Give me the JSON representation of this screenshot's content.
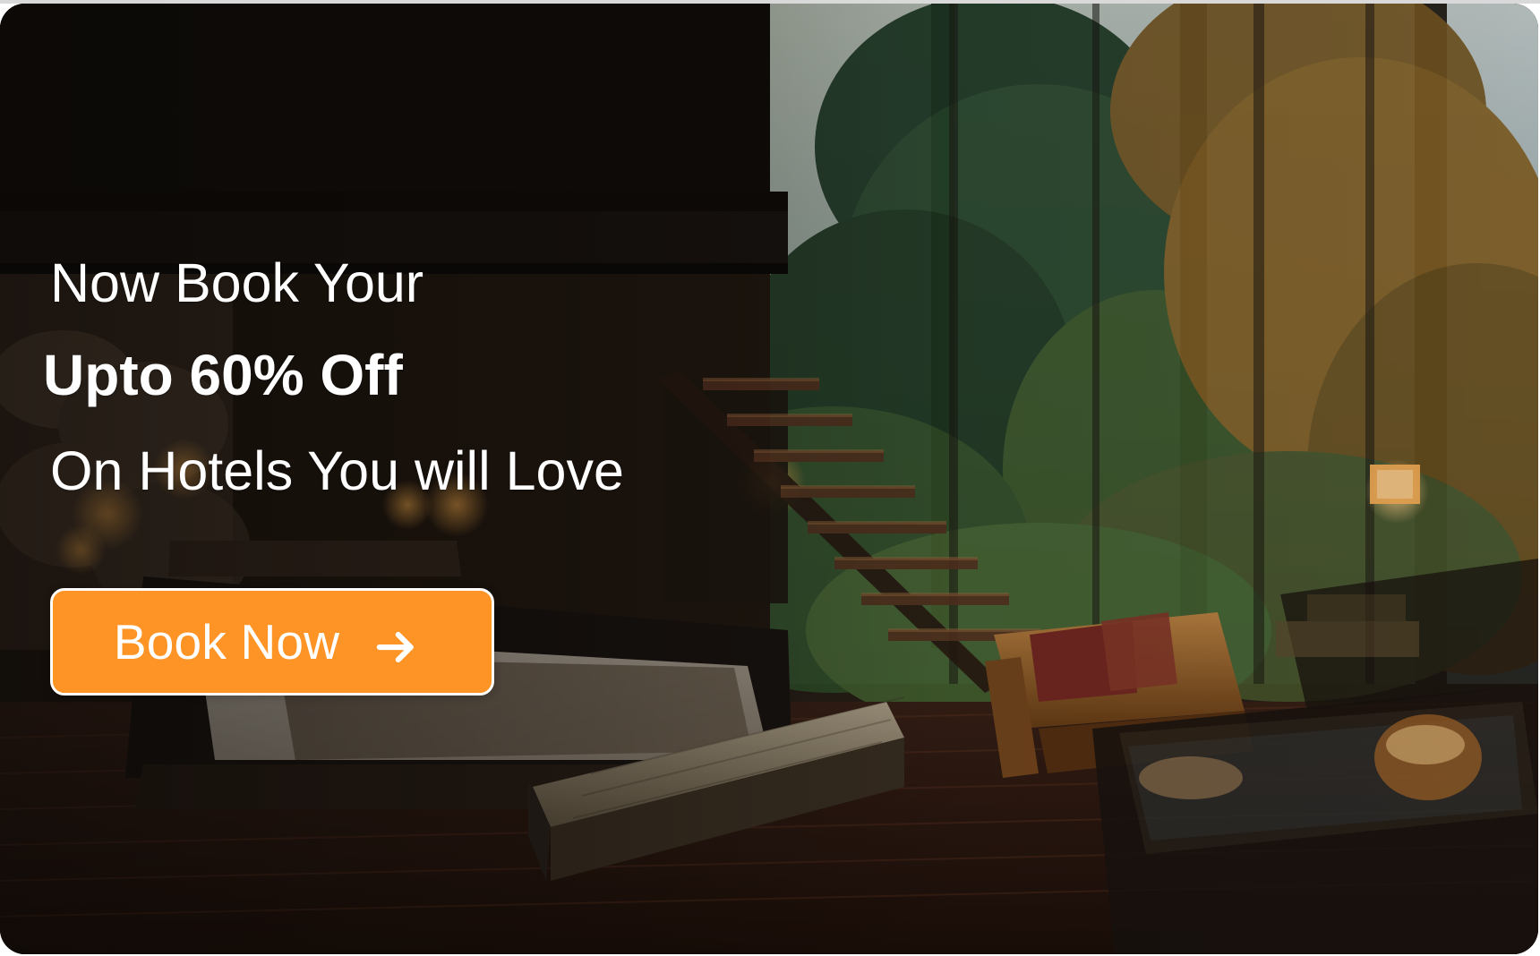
{
  "banner": {
    "headline_line_1": "Now Book Your",
    "headline_line_2": "Upto 60% Off",
    "headline_line_3": "On Hotels You will Love",
    "cta_label": "Book Now",
    "cta_icon": "arrow-right-icon",
    "background_description_icon": "forest-hotel-interior-image"
  },
  "colors": {
    "cta_background": "#ff9426",
    "cta_border": "#ffffff",
    "text": "#ffffff"
  }
}
